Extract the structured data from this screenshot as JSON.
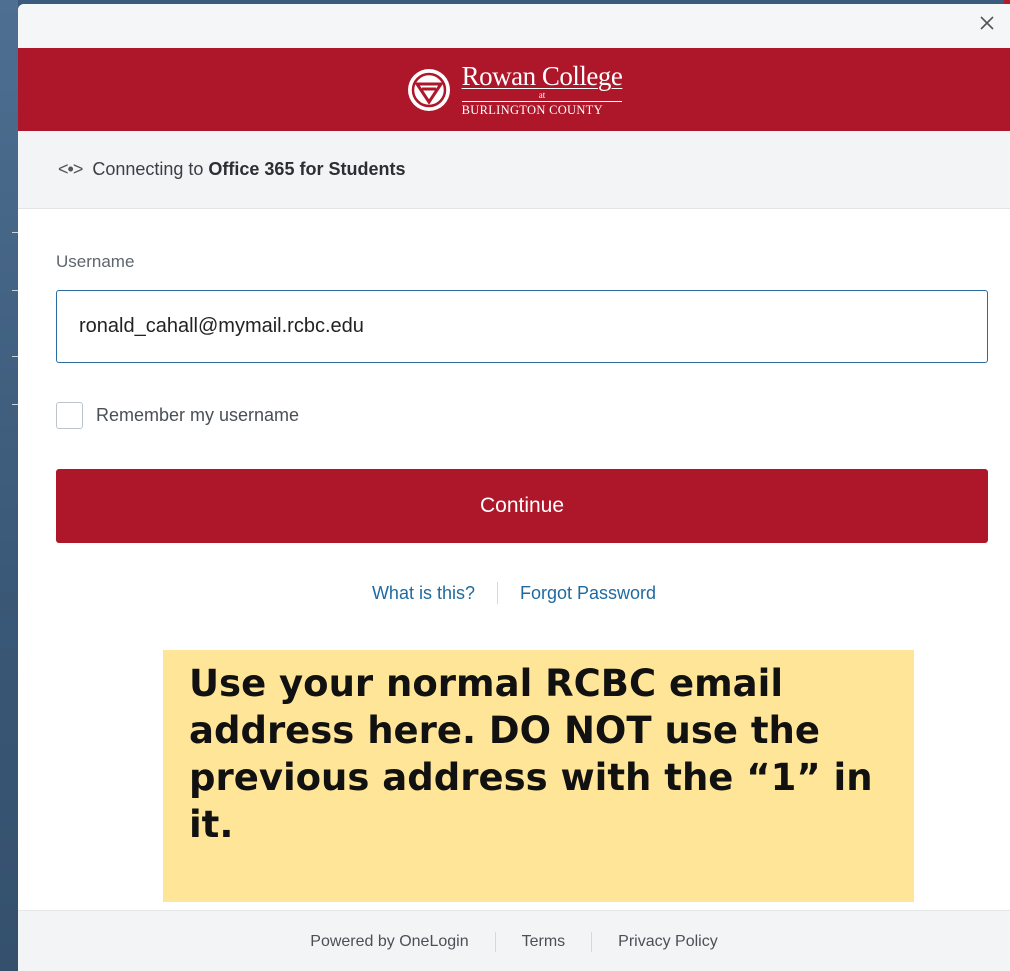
{
  "brand": {
    "name": "Rowan College",
    "at": "at",
    "sub": "BURLINGTON COUNTY",
    "color": "#ad1729"
  },
  "connection": {
    "prefix": "Connecting to",
    "target": "Office 365 for Students",
    "icon": "connect-arrows-icon"
  },
  "form": {
    "username_label": "Username",
    "username_value": "ronald_cahall@mymail.rcbc.edu",
    "remember_label": "Remember my username",
    "remember_checked": false,
    "continue_label": "Continue"
  },
  "links": {
    "what_is_this": "What is this?",
    "forgot_password": "Forgot Password"
  },
  "callout": {
    "text": "Use your normal RCBC email address here. DO NOT use the previous address with the “1” in it."
  },
  "footer": {
    "powered_by": "Powered by OneLogin",
    "terms": "Terms",
    "privacy": "Privacy Policy"
  }
}
